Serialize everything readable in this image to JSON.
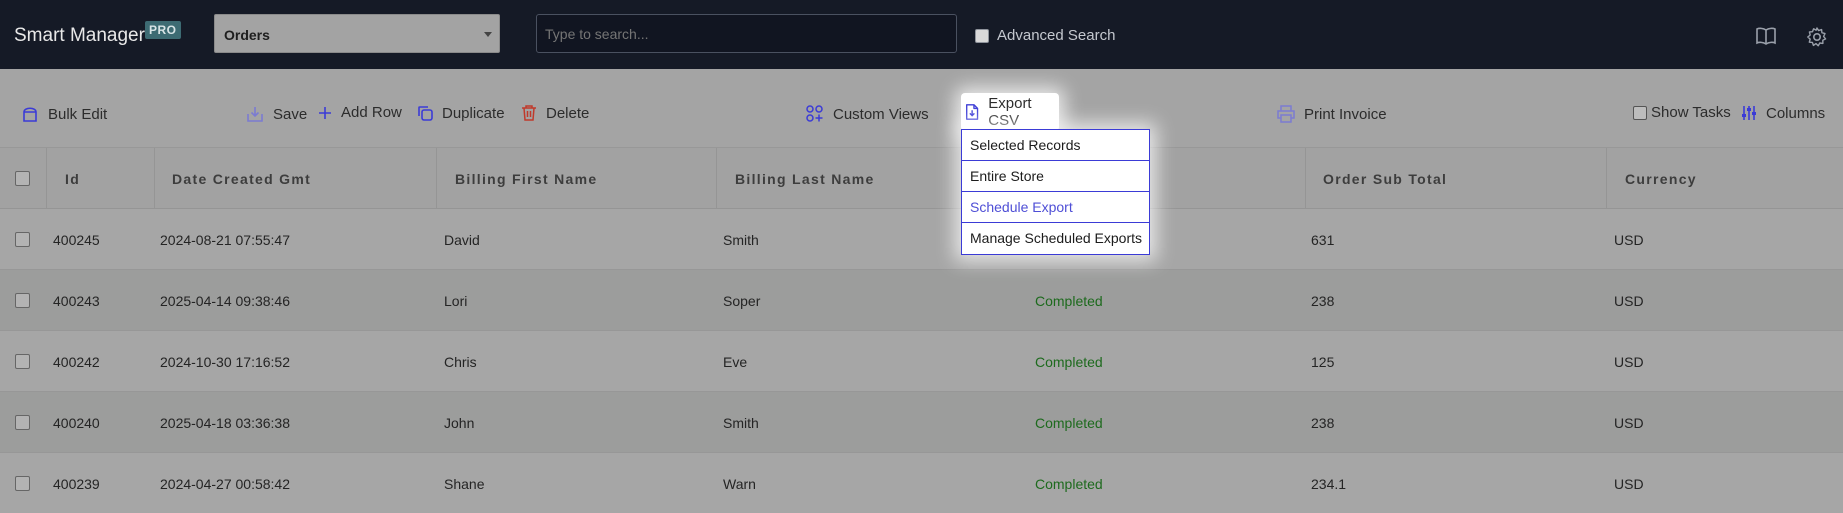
{
  "topbar": {
    "brand": "Smart Manager",
    "badge": "PRO",
    "entity_selected": "Orders",
    "search_placeholder": "Type to search...",
    "advanced_search_label": "Advanced Search",
    "icons": [
      "book-icon",
      "gear-icon"
    ]
  },
  "toolbar": {
    "bulk_edit": "Bulk Edit",
    "save": "Save",
    "add_row": "Add Row",
    "duplicate": "Duplicate",
    "delete": "Delete",
    "custom_views": "Custom Views",
    "export_csv": "Export CSV",
    "print_invoice": "Print Invoice",
    "show_tasks": "Show Tasks",
    "columns": "Columns"
  },
  "export_menu": {
    "items": [
      "Selected Records",
      "Entire Store",
      "Schedule Export",
      "Manage Scheduled Exports"
    ],
    "highlighted": "Schedule Export"
  },
  "table": {
    "headers": [
      "Id",
      "Date Created Gmt",
      "Billing First Name",
      "Billing Last Name",
      "Order Sub Total",
      "Currency"
    ],
    "rows": [
      {
        "id": "400245",
        "date": "2024-08-21 07:55:47",
        "first": "David",
        "last": "Smith",
        "status": "",
        "subtotal": "631",
        "currency": "USD"
      },
      {
        "id": "400243",
        "date": "2025-04-14 09:38:46",
        "first": "Lori",
        "last": "Soper",
        "status": "Completed",
        "subtotal": "238",
        "currency": "USD"
      },
      {
        "id": "400242",
        "date": "2024-10-30 17:16:52",
        "first": "Chris",
        "last": "Eve",
        "status": "Completed",
        "subtotal": "125",
        "currency": "USD"
      },
      {
        "id": "400240",
        "date": "2025-04-18 03:36:38",
        "first": "John",
        "last": "Smith",
        "status": "Completed",
        "subtotal": "238",
        "currency": "USD"
      },
      {
        "id": "400239",
        "date": "2024-04-27 00:58:42",
        "first": "Shane",
        "last": "Warn",
        "status": "Completed",
        "subtotal": "234.1",
        "currency": "USD"
      }
    ]
  },
  "colors": {
    "accent": "#3b3bd6",
    "delete": "#c0392b",
    "status_completed": "#1d6a1d",
    "topbar_bg": "#151a26"
  }
}
